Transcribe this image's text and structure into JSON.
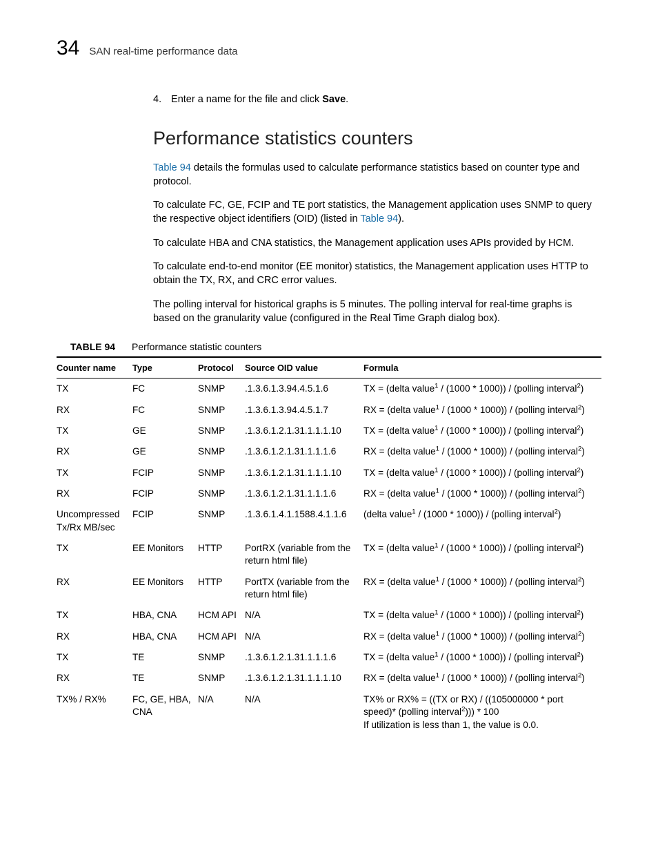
{
  "header": {
    "chapter_number": "34",
    "chapter_title": "SAN real-time performance data"
  },
  "step": {
    "number": "4.",
    "text_before": "Enter a name for the file and click ",
    "bold_word": "Save",
    "text_after": "."
  },
  "section": {
    "heading": "Performance statistics counters",
    "p1_link": "Table 94",
    "p1_rest": " details the formulas used to calculate performance statistics based on counter type and protocol.",
    "p2_before": "To calculate FC, GE, FCIP and TE port statistics, the Management application uses SNMP to query the respective object identifiers (OID) (listed in ",
    "p2_link": "Table 94",
    "p2_after": ").",
    "p3": "To calculate HBA and CNA statistics, the Management application uses APIs provided by HCM.",
    "p4": "To calculate end-to-end monitor (EE monitor) statistics, the Management application uses HTTP to obtain the TX, RX, and CRC error values.",
    "p5": "The polling interval for historical graphs is 5 minutes. The polling interval for real-time graphs is based on the granularity value (configured in the Real Time Graph dialog box)."
  },
  "table": {
    "label": "TABLE 94",
    "caption": "Performance statistic counters",
    "headers": {
      "counter": "Counter name",
      "type": "Type",
      "protocol": "Protocol",
      "oid": "Source OID value",
      "formula": "Formula"
    },
    "rows": [
      {
        "counter": "TX",
        "type": "FC",
        "protocol": "SNMP",
        "oid": ".1.3.6.1.3.94.4.5.1.6",
        "formula": "TX = (delta value<sup>1</sup> / (1000 * 1000)) / (polling interval<sup>2</sup>)"
      },
      {
        "counter": "RX",
        "type": "FC",
        "protocol": "SNMP",
        "oid": ".1.3.6.1.3.94.4.5.1.7",
        "formula": "RX = (delta value<sup>1</sup> / (1000 * 1000)) / (polling interval<sup>2</sup>)"
      },
      {
        "counter": "TX",
        "type": "GE",
        "protocol": "SNMP",
        "oid": ".1.3.6.1.2.1.31.1.1.1.10",
        "formula": "TX = (delta value<sup>1</sup> / (1000 * 1000)) / (polling interval<sup>2</sup>)"
      },
      {
        "counter": "RX",
        "type": "GE",
        "protocol": "SNMP",
        "oid": ".1.3.6.1.2.1.31.1.1.1.6",
        "formula": "RX = (delta value<sup>1</sup> / (1000 * 1000)) / (polling interval<sup>2</sup>)"
      },
      {
        "counter": "TX",
        "type": "FCIP",
        "protocol": "SNMP",
        "oid": ".1.3.6.1.2.1.31.1.1.1.10",
        "formula": "TX = (delta value<sup>1</sup> / (1000 * 1000)) / (polling interval<sup>2</sup>)"
      },
      {
        "counter": "RX",
        "type": "FCIP",
        "protocol": "SNMP",
        "oid": ".1.3.6.1.2.1.31.1.1.1.6",
        "formula": "RX = (delta value<sup>1</sup> / (1000 * 1000)) / (polling interval<sup>2</sup>)"
      },
      {
        "counter": "Uncompressed Tx/Rx MB/sec",
        "type": "FCIP",
        "protocol": "SNMP",
        "oid": ".1.3.6.1.4.1.1588.4.1.1.6",
        "formula": "(delta value<sup>1</sup> / (1000 * 1000)) / (polling interval<sup>2</sup>)"
      },
      {
        "counter": "TX",
        "type": "EE Monitors",
        "protocol": "HTTP",
        "oid": "PortRX (variable from the return html file)",
        "formula": "TX = (delta value<sup>1</sup> / (1000 * 1000)) / (polling interval<sup>2</sup>)"
      },
      {
        "counter": "RX",
        "type": "EE Monitors",
        "protocol": "HTTP",
        "oid": "PortTX (variable from the return html file)",
        "formula": "RX = (delta value<sup>1</sup> / (1000 * 1000)) / (polling interval<sup>2</sup>)"
      },
      {
        "counter": "TX",
        "type": "HBA, CNA",
        "protocol": "HCM API",
        "oid": "N/A",
        "formula": "TX = (delta value<sup>1</sup> / (1000 * 1000)) / (polling interval<sup>2</sup>)"
      },
      {
        "counter": "RX",
        "type": "HBA, CNA",
        "protocol": "HCM API",
        "oid": "N/A",
        "formula": "RX = (delta value<sup>1</sup> / (1000 * 1000)) / (polling interval<sup>2</sup>)"
      },
      {
        "counter": "TX",
        "type": "TE",
        "protocol": "SNMP",
        "oid": ".1.3.6.1.2.1.31.1.1.1.6",
        "formula": "TX = (delta value<sup>1</sup> / (1000 * 1000)) / (polling interval<sup>2</sup>)"
      },
      {
        "counter": "RX",
        "type": "TE",
        "protocol": "SNMP",
        "oid": ".1.3.6.1.2.1.31.1.1.1.10",
        "formula": "RX = (delta value<sup>1</sup> / (1000 * 1000)) / (polling interval<sup>2</sup>)"
      },
      {
        "counter": "TX% / RX%",
        "type": "FC, GE, HBA, CNA",
        "protocol": "N/A",
        "oid": "N/A",
        "formula": "TX% or RX% = ((TX or RX) / ((105000000 * port speed)* (polling interval<sup>2</sup>))) * 100<span class=\"formula-note\">If utilization is less than 1, the value is 0.0.</span>"
      }
    ]
  }
}
